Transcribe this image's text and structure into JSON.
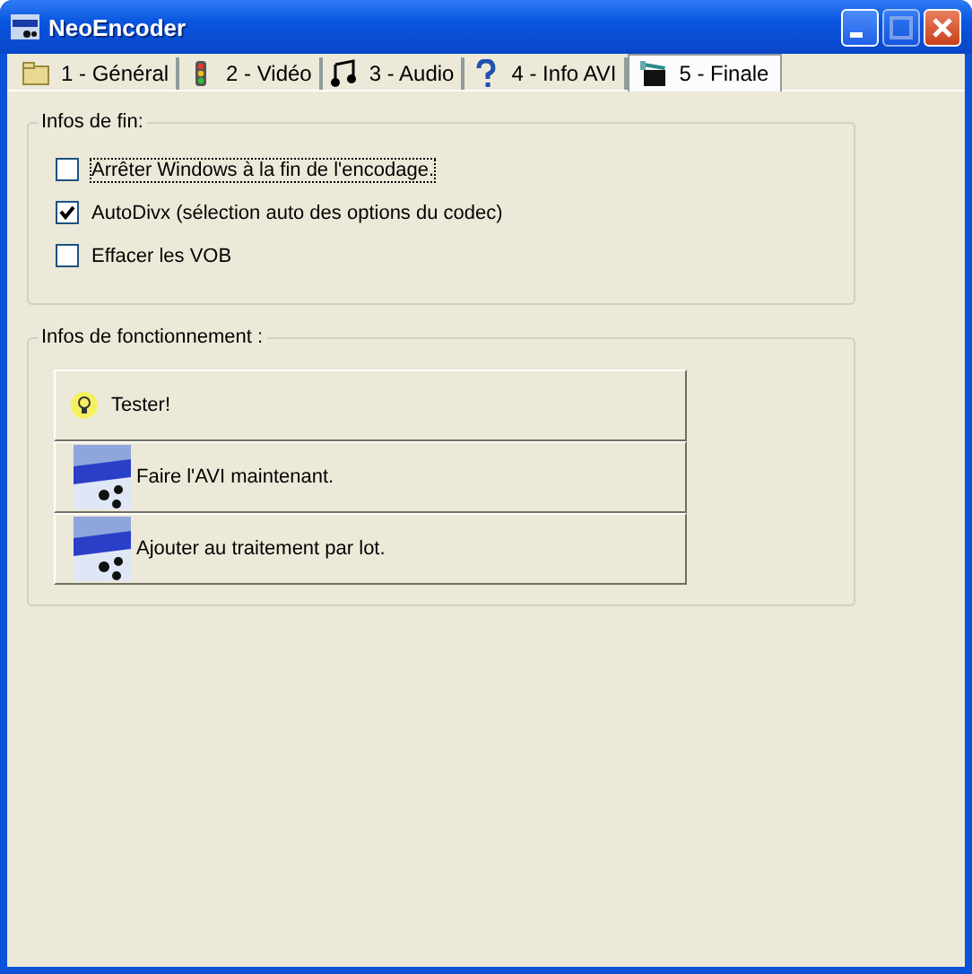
{
  "window": {
    "title": "NeoEncoder"
  },
  "tabs": [
    {
      "label": "1 - Général",
      "selected": false
    },
    {
      "label": "2 - Vidéo",
      "selected": false
    },
    {
      "label": "3 - Audio",
      "selected": false
    },
    {
      "label": "4 - Info AVI",
      "selected": false
    },
    {
      "label": "5 - Finale",
      "selected": true
    }
  ],
  "end_group": {
    "title": "Infos de fin:",
    "options": [
      {
        "label": "Arrêter Windows à la fin de l'encodage.",
        "checked": false,
        "focused": true
      },
      {
        "label": "AutoDivx (sélection auto des options du codec)",
        "checked": true,
        "focused": false
      },
      {
        "label": "Effacer les VOB",
        "checked": false,
        "focused": false
      }
    ]
  },
  "action_group": {
    "title": "Infos de fonctionnement :",
    "buttons": [
      {
        "label": "Tester!",
        "kind": "tip"
      },
      {
        "label": "Faire l'AVI maintenant.",
        "kind": "logo"
      },
      {
        "label": "Ajouter au traitement par lot.",
        "kind": "logo"
      }
    ]
  }
}
